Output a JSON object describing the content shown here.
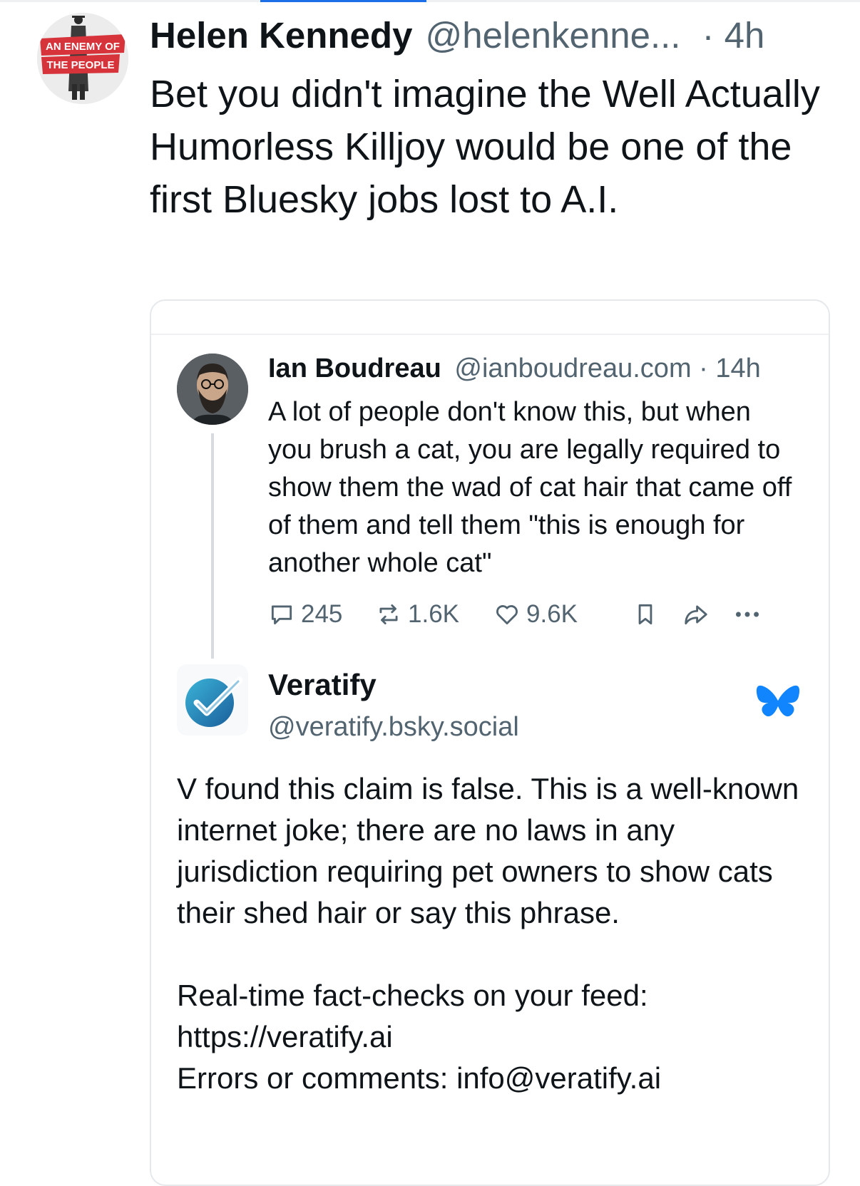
{
  "post": {
    "author_name": "Helen Kennedy",
    "author_handle": "@helenkenne...",
    "timestamp": "· 4h",
    "text": "Bet you didn't imagine the Well Actually Humorless Killjoy would be one of the first Bluesky jobs lost to A.I.",
    "avatar_badge_line1": "AN ENEMY OF",
    "avatar_badge_line2": "THE PEOPLE"
  },
  "quoted": {
    "original": {
      "author_name": "Ian Boudreau",
      "author_handle": "@ianboudreau.com · 14h",
      "text": "A lot of people don't know this, but when you brush a cat, you are legally required to show them the wad of cat hair that came off of them and tell them \"this is enough for another whole cat\"",
      "actions": {
        "replies": "245",
        "reposts": "1.6K",
        "likes": "9.6K",
        "icons": [
          "reply-icon",
          "repost-icon",
          "like-icon",
          "bookmark-icon",
          "share-icon",
          "more-icon"
        ]
      }
    },
    "reply": {
      "author_name": "Veratify",
      "author_handle": "@veratify.bsky.social",
      "paragraph1": "V found this claim is false. This is a well-known internet joke; there are no laws in any jurisdiction requiring pet owners to show cats their shed hair or say this phrase.",
      "line2": "Real-time fact-checks on your feed:",
      "line3": "https://veratify.ai",
      "line4": "Errors or comments: info@veratify.ai",
      "badge_icon": "bluesky-butterfly-icon"
    }
  },
  "colors": {
    "accent": "#1d6fe8",
    "secondary_text": "#536471",
    "badge_red": "#d6333b",
    "butterfly_blue": "#1185fe"
  }
}
